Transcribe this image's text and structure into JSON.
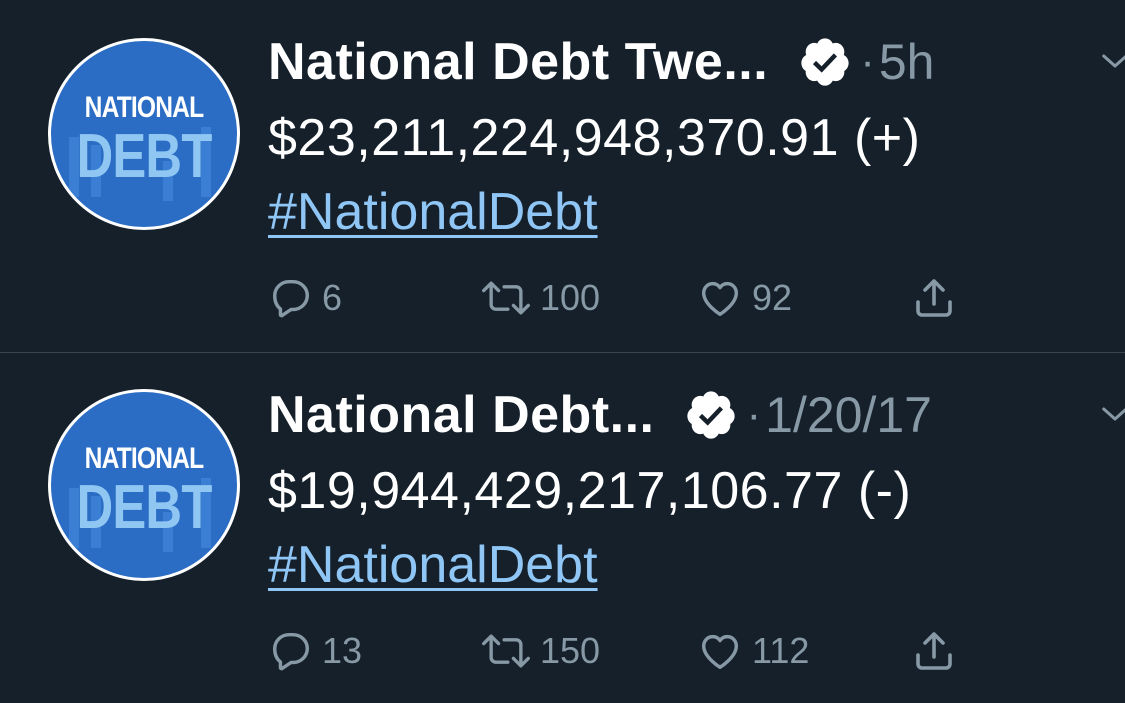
{
  "tweets": [
    {
      "avatar": {
        "line1": "NATIONAL",
        "line2": "DEBT"
      },
      "name": "National Debt Twe...",
      "time": "5h",
      "amount": "$23,211,224,948,370.91 (+)",
      "hashtag": "#NationalDebt",
      "replies": "6",
      "retweets": "100",
      "likes": "92"
    },
    {
      "avatar": {
        "line1": "NATIONAL",
        "line2": "DEBT"
      },
      "name": "National Debt...",
      "time": "1/20/17",
      "amount": "$19,944,429,217,106.77 (-)",
      "hashtag": "#NationalDebt",
      "replies": "13",
      "retweets": "150",
      "likes": "112"
    }
  ],
  "separator": "·",
  "icons": [
    "verified-icon",
    "chevron-down-icon",
    "reply-icon",
    "retweet-icon",
    "like-icon",
    "share-icon"
  ],
  "colors": {
    "background": "#15202b",
    "muted": "#8899a6",
    "link": "#8fc6f5",
    "avatar_blue": "#2b6cc4",
    "divider": "#38444d"
  }
}
